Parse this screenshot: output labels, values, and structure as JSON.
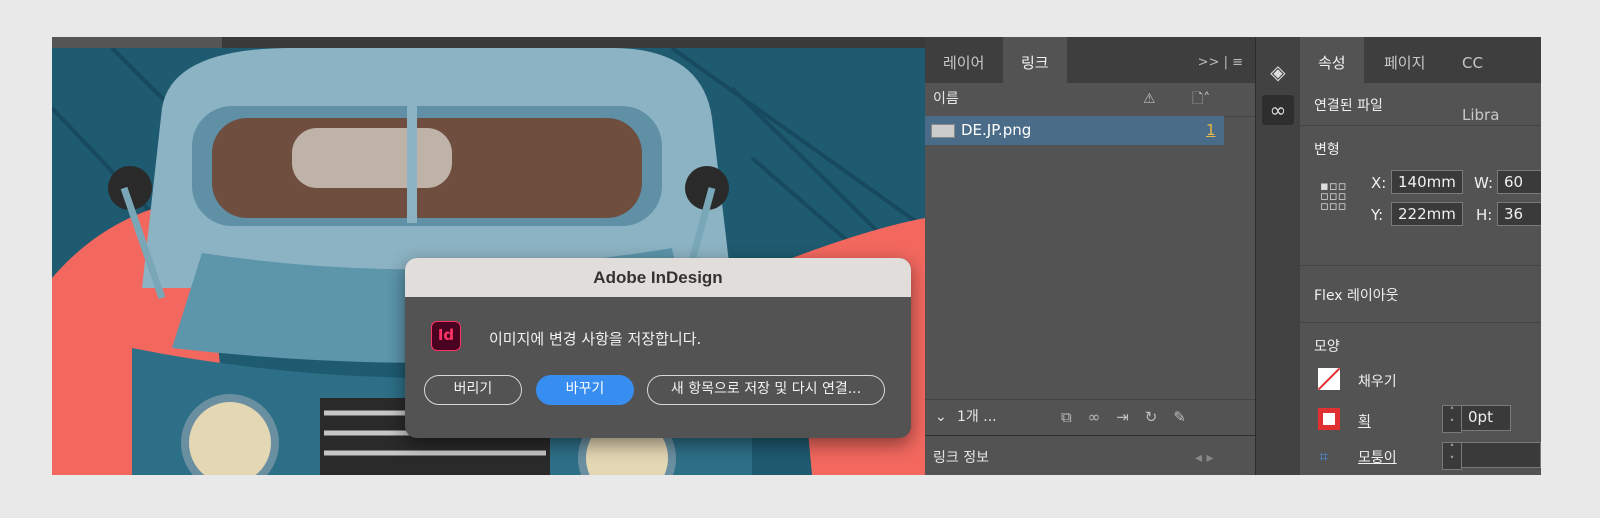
{
  "dialog": {
    "title": "Adobe InDesign",
    "message": "이미지에 변경 사항을 저장합니다.",
    "app_icon_text": "Id",
    "buttons": {
      "discard": "버리기",
      "replace": "바꾸기",
      "save_as_relink": "새 항목으로 저장 및 다시 연결..."
    },
    "colors": {
      "primary": "#378ef0",
      "icon_accent": "#ff3366"
    }
  },
  "links_panel": {
    "tabs": [
      "레이어",
      "링크"
    ],
    "active_tab": "링크",
    "overflow": ">>",
    "column_name": "이름",
    "items": [
      {
        "name": "DE.JP.png",
        "page": "1"
      }
    ],
    "footer_count": "1개 ...",
    "link_info_title": "링크 정보"
  },
  "properties_panel": {
    "tabs": [
      "속성",
      "페이지",
      "CC Libra"
    ],
    "active_tab": "속성",
    "linked_file": "연결된 파일",
    "transform": {
      "title": "변형",
      "x_label": "X:",
      "x_value": "140mm",
      "y_label": "Y:",
      "y_value": "222mm",
      "w_label": "W:",
      "w_value": "60",
      "h_label": "H:",
      "h_value": "36"
    },
    "flex_layout": "Flex 레이아웃",
    "appearance": {
      "title": "모양",
      "fill": "채우기",
      "stroke": "획",
      "stroke_value": "0pt",
      "corner": "모퉁이"
    }
  }
}
